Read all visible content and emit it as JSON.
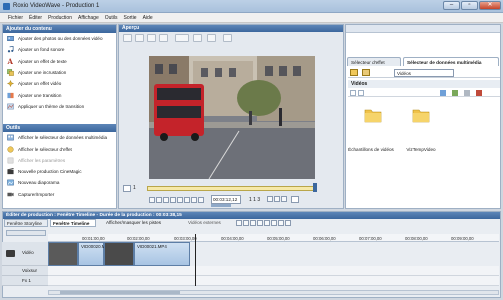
{
  "window": {
    "title": "Roxio VideoWave - Production 1",
    "min": "–",
    "max": "▫",
    "close": "✕"
  },
  "menu": [
    "Fichier",
    "Éditer",
    "Production",
    "Affichage",
    "Outils",
    "Sortie",
    "Aide"
  ],
  "left_panel": {
    "section1_title": "Ajouter du contenu",
    "section1_items": [
      {
        "label": "Ajouter des photos ou des données vidéo",
        "icon": "add-media-icon",
        "enabled": true
      },
      {
        "label": "Ajouter un fond sonore",
        "icon": "music-icon",
        "enabled": true
      },
      {
        "label": "Ajouter un effet de texte",
        "icon": "text-effect-icon",
        "enabled": true
      },
      {
        "label": "Ajouter une incrustation",
        "icon": "overlay-icon",
        "enabled": true
      },
      {
        "label": "Ajouter un effet vidéo",
        "icon": "video-effect-icon",
        "enabled": true
      },
      {
        "label": "Ajouter une transition",
        "icon": "transition-icon",
        "enabled": true
      },
      {
        "label": "Appliquer un thème de transition",
        "icon": "theme-icon",
        "enabled": true
      }
    ],
    "section2_title": "Outils",
    "section2_items": [
      {
        "label": "Afficher le sélecteur de données multimédia",
        "icon": "media-selector-icon",
        "enabled": true
      },
      {
        "label": "Afficher le sélecteur d'effet",
        "icon": "effect-selector-icon",
        "enabled": true
      },
      {
        "label": "Afficher les paramètres",
        "icon": "settings-icon",
        "enabled": false
      },
      {
        "label": "Nouvelle production CineMagic",
        "icon": "cinemagic-icon",
        "enabled": true
      },
      {
        "label": "Nouveau diaporama",
        "icon": "slideshow-icon",
        "enabled": true
      },
      {
        "label": "Capturer/Importer",
        "icon": "capture-icon",
        "enabled": true
      }
    ]
  },
  "preview": {
    "title": "Aperçu",
    "frame_number": "1",
    "timecode": "00:03:12,12",
    "page_current": "1",
    "page_of": "1",
    "page_total": "3"
  },
  "right_panel": {
    "tab_effects": "Sélecteur d'effet",
    "tab_media": "Sélecteur de données multimédia",
    "folder_select": "Vidéos",
    "section_title": "Vidéos",
    "folders": [
      {
        "label": "Échantillons de vidéos",
        "icon": "folder-icon"
      },
      {
        "label": "VizTempVideo",
        "icon": "folder-icon"
      }
    ]
  },
  "timeline": {
    "title": "Éditer de production : Fenêtre Timeline - Durée de la production : 00:03:38,15",
    "tab_storyline": "Fenêtre Storyline",
    "tab_timeline": "Fenêtre Timeline",
    "show_hide_tracks": "Afficher/masquer les pistes",
    "external_videos": "Vidéos externes",
    "ruler": [
      "00:01:00,00",
      "00:02:00,00",
      "00:03:00,00",
      "00:04:00,00",
      "00:05:00,00",
      "00:06:00,00",
      "00:07:00,00",
      "00:08:00,00",
      "00:09:00,00"
    ],
    "tracks": [
      "Vidéo",
      "Voixsur",
      "Fx 1"
    ],
    "clips": [
      "VID00020.MP4",
      "VID00021.MP4"
    ]
  },
  "colors": {
    "accent": "#3c679d",
    "clip": "#a8c4e3"
  }
}
